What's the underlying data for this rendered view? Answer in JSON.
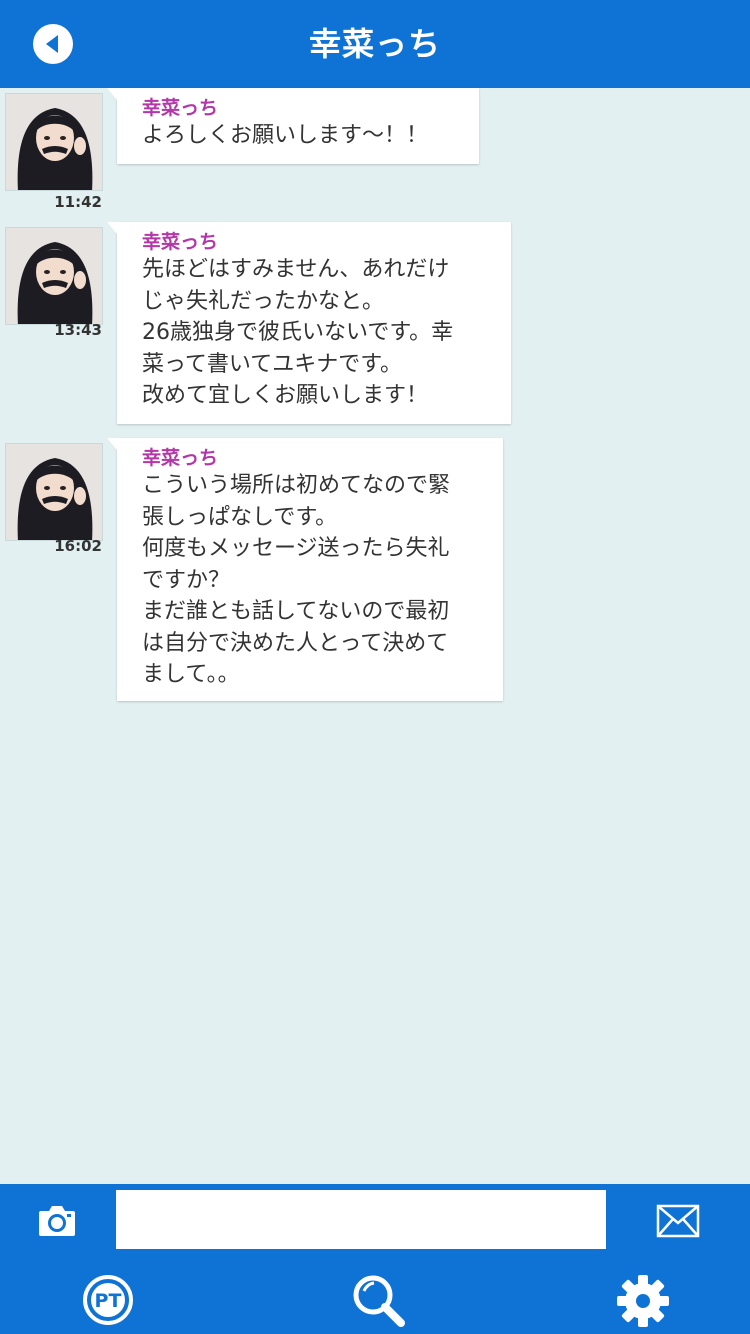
{
  "header": {
    "title": "幸菜っち",
    "back_icon": "back-arrow-icon",
    "color": "#0f73d6"
  },
  "messages": [
    {
      "sender": "幸菜っち",
      "time": "11:42",
      "text": "よろしくお願いします～！！"
    },
    {
      "sender": "幸菜っち",
      "time": "13:43",
      "text": "先ほどはすみません、あれだけ\nじゃ失礼だったかなと。\n26歳独身で彼氏いないです。幸\n菜って書いてユキナです。\n改めて宜しくお願いします！"
    },
    {
      "sender": "幸菜っち",
      "time": "16:02",
      "text": "こういう場所は初めてなので緊\n張しっぱなしです。\n何度もメッセージ送ったら失礼\nですか？\nまだ誰とも話してないので最初\nは自分で決めた人とって決めて\nまして。。"
    }
  ],
  "composer": {
    "camera_icon": "camera-icon",
    "input_value": "",
    "send_icon": "envelope-icon"
  },
  "bottom_nav": {
    "items": [
      {
        "icon": "pt-icon",
        "label": "PT"
      },
      {
        "icon": "search-icon"
      },
      {
        "icon": "gear-icon"
      }
    ]
  },
  "colors": {
    "accent": "#0f73d6",
    "background": "#e2f0f2",
    "sender_name": "#b337a8",
    "text": "#333333"
  }
}
